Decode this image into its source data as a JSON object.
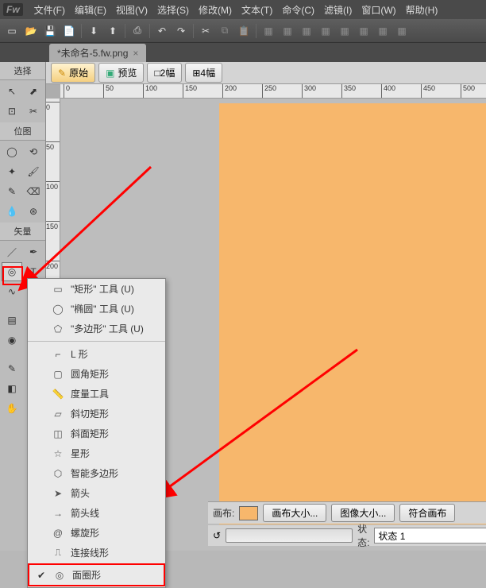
{
  "app_logo": "Fw",
  "menu": [
    "文件(F)",
    "编辑(E)",
    "视图(V)",
    "选择(S)",
    "修改(M)",
    "文本(T)",
    "命令(C)",
    "滤镜(I)",
    "窗口(W)",
    "帮助(H)"
  ],
  "doc_tab": {
    "title": "*未命名-5.fw.png",
    "close": "×"
  },
  "left_labels": {
    "select": "选择",
    "bitmap": "位图",
    "vector": "矢量"
  },
  "view_bar": {
    "orig": "原始",
    "preview": "预览",
    "two_up": "□2幅",
    "four_up": "⊞4幅"
  },
  "ruler_marks": [
    "0",
    "50",
    "100",
    "150",
    "200",
    "250",
    "300",
    "350",
    "400",
    "450",
    "500"
  ],
  "flyout": {
    "rect": "\"矩形\" 工具 (U)",
    "ellipse": "\"椭圆\" 工具 (U)",
    "polygon": "\"多边形\" 工具 (U)",
    "lshape": "L 形",
    "roundrect": "圆角矩形",
    "measure": "度量工具",
    "skewrect": "斜切矩形",
    "skewface": "斜面矩形",
    "star": "星形",
    "smartpoly": "智能多边形",
    "arrow": "箭头",
    "arrowline": "箭头线",
    "spiral": "螺旋形",
    "connector": "连接线形",
    "donut": "面圈形"
  },
  "prop": {
    "canvas": "画布:",
    "size": "画布大小...",
    "imgsize": "图像大小...",
    "fit": "符合画布"
  },
  "state": {
    "label": "状态:",
    "value": "状态 1"
  }
}
